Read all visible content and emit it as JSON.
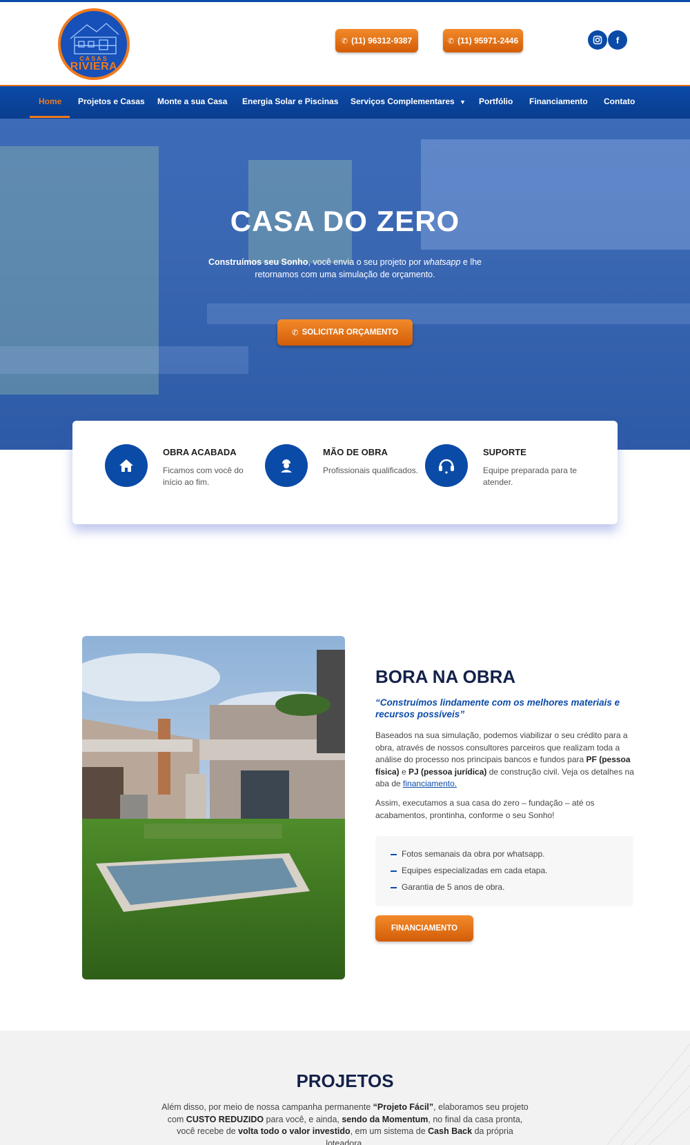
{
  "brand": {
    "logo_small": "CASAS",
    "logo_big": "RIVIERA"
  },
  "header": {
    "phone1": "(11) 96312-9387",
    "phone2": "(11) 95971-2446",
    "social": [
      "instagram-icon",
      "facebook-icon"
    ]
  },
  "nav": {
    "items": [
      {
        "label": "Home",
        "active": true
      },
      {
        "label": "Projetos e Casas"
      },
      {
        "label": "Monte a sua Casa"
      },
      {
        "label": "Energia Solar e Piscinas"
      },
      {
        "label": "Serviços Complementares",
        "dropdown": true
      },
      {
        "label": "Portfólio"
      },
      {
        "label": "Financiamento"
      },
      {
        "label": "Contato"
      }
    ]
  },
  "hero": {
    "title": "CASA DO ZERO",
    "sub_bold": "Construímos seu Sonho",
    "sub_mid": ", você envia o seu projeto por ",
    "sub_italic": "whatsapp",
    "sub_end": " e lhe retornamos com uma simulação de orçamento.",
    "button": "SOLICITAR ORÇAMENTO"
  },
  "features": [
    {
      "icon": "home-icon",
      "title": "OBRA ACABADA",
      "desc": "Ficamos com você do início ao fim."
    },
    {
      "icon": "worker-icon",
      "title": "MÃO DE OBRA",
      "desc": "Profissionais qualificados."
    },
    {
      "icon": "headset-icon",
      "title": "SUPORTE",
      "desc": "Equipe preparada para te atender."
    }
  ],
  "bora": {
    "title": "BORA NA OBRA",
    "quote": "“Construímos lindamente com os melhores materiais e recursos possíveis”",
    "p1_a": "Baseados na sua simulação, podemos viabilizar o seu crédito para a obra, através de nossos consultores parceiros que realizam toda a análise do processo nos principais bancos e fundos para ",
    "p1_b1": "PF (pessoa física)",
    "p1_c": " e ",
    "p1_b2": "PJ (pessoa jurídica)",
    "p1_d": " de construção civil. Veja os detalhes na aba de ",
    "p1_link": "financiamento.",
    "p2": "Assim, executamos a sua casa do zero – fundação – até os acabamentos, prontinha, conforme o seu Sonho!",
    "list": [
      "Fotos semanais da obra por whatsapp.",
      "Equipes especializadas em cada etapa.",
      "Garantia de 5 anos de obra."
    ],
    "button": "FINANCIAMENTO"
  },
  "projetos": {
    "title": "PROJETOS",
    "t1": "Além disso, por meio de nossa campanha permanente ",
    "b1": "“Projeto Fácil”",
    "t2": ", elaboramos seu projeto com ",
    "b2": "CUSTO REDUZIDO",
    "t3": " para você, e ainda, ",
    "b3": "sendo da Momentum",
    "t4": ", no final da casa pronta, você recebe de ",
    "b4": "volta todo o valor investido",
    "t5": ", em um sistema de ",
    "b5": "Cash Back",
    "t6": " da própria loteadora."
  },
  "colors": {
    "primary": "#0b4ba8",
    "accent": "#f07a1c",
    "heading": "#14224a"
  }
}
